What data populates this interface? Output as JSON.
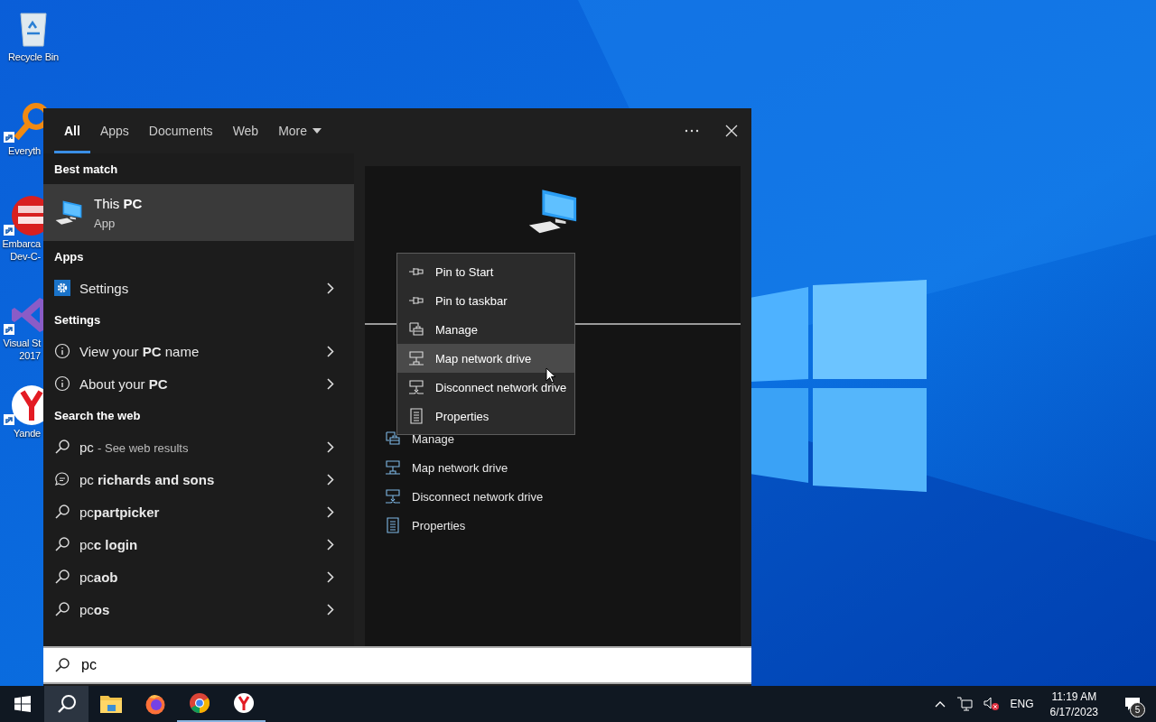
{
  "desktop_icons": [
    {
      "kind": "recycle",
      "lines": [
        "Recycle Bin"
      ],
      "shortcut": false
    },
    {
      "kind": "magnifier",
      "lines": [
        "Everyth"
      ],
      "shortcut": true
    },
    {
      "kind": "devcpp",
      "lines": [
        "Embarca",
        "Dev-C-"
      ],
      "shortcut": true
    },
    {
      "kind": "vstudio",
      "lines": [
        "Visual St",
        "2017"
      ],
      "shortcut": true
    },
    {
      "kind": "yandex",
      "lines": [
        "Yande"
      ],
      "shortcut": true
    }
  ],
  "search_panel": {
    "tabs": [
      {
        "label": "All",
        "selected": true,
        "dropdown": false
      },
      {
        "label": "Apps",
        "selected": false,
        "dropdown": false
      },
      {
        "label": "Documents",
        "selected": false,
        "dropdown": false
      },
      {
        "label": "Web",
        "selected": false,
        "dropdown": false
      },
      {
        "label": "More",
        "selected": false,
        "dropdown": true
      }
    ],
    "best_match": {
      "heading": "Best match",
      "title": "This **PC**",
      "subtitle": "App",
      "selected": true
    },
    "sections": [
      {
        "heading": "Apps",
        "items": [
          {
            "kind": "settings",
            "label": "Settings"
          }
        ]
      },
      {
        "heading": "Settings",
        "items": [
          {
            "kind": "info",
            "label": "View your **PC** name"
          },
          {
            "kind": "info",
            "label": "About your **PC**"
          }
        ]
      },
      {
        "heading": "Search the web",
        "items": [
          {
            "kind": "search",
            "label": "pc",
            "hint": "- See web results"
          },
          {
            "kind": "chat",
            "label": "pc **richards and sons**"
          },
          {
            "kind": "search",
            "label": "pc**partpicker**"
          },
          {
            "kind": "search",
            "label": "pc**c login**"
          },
          {
            "kind": "search",
            "label": "pc**aob**"
          },
          {
            "kind": "search",
            "label": "pc**os**"
          }
        ]
      }
    ],
    "preview": {
      "actions": [
        {
          "kind": "manage",
          "label": "Manage"
        },
        {
          "kind": "network",
          "label": "Map network drive"
        },
        {
          "kind": "disconnect",
          "label": "Disconnect network drive"
        },
        {
          "kind": "properties",
          "label": "Properties"
        }
      ]
    },
    "context_menu": {
      "items": [
        {
          "kind": "pin",
          "label": "Pin to Start",
          "selected": false
        },
        {
          "kind": "pin",
          "label": "Pin to taskbar",
          "selected": false
        },
        {
          "kind": "manage",
          "label": "Manage",
          "selected": false
        },
        {
          "kind": "network",
          "label": "Map network drive",
          "selected": true
        },
        {
          "kind": "disconnect",
          "label": "Disconnect network drive",
          "selected": false
        },
        {
          "kind": "properties",
          "label": "Properties",
          "selected": false
        }
      ]
    },
    "search_box": {
      "value": "pc"
    }
  },
  "taskbar": {
    "apps": [
      {
        "kind": "start",
        "active": false,
        "running": false
      },
      {
        "kind": "search",
        "active": true,
        "running": false
      },
      {
        "kind": "explorer",
        "active": false,
        "running": false
      },
      {
        "kind": "firefox",
        "active": false,
        "running": false
      },
      {
        "kind": "chrome",
        "active": false,
        "running": true
      },
      {
        "kind": "yandex",
        "active": false,
        "running": true
      }
    ],
    "language": "ENG",
    "time": "11:19 AM",
    "date": "6/17/2023",
    "notifications": "5"
  }
}
